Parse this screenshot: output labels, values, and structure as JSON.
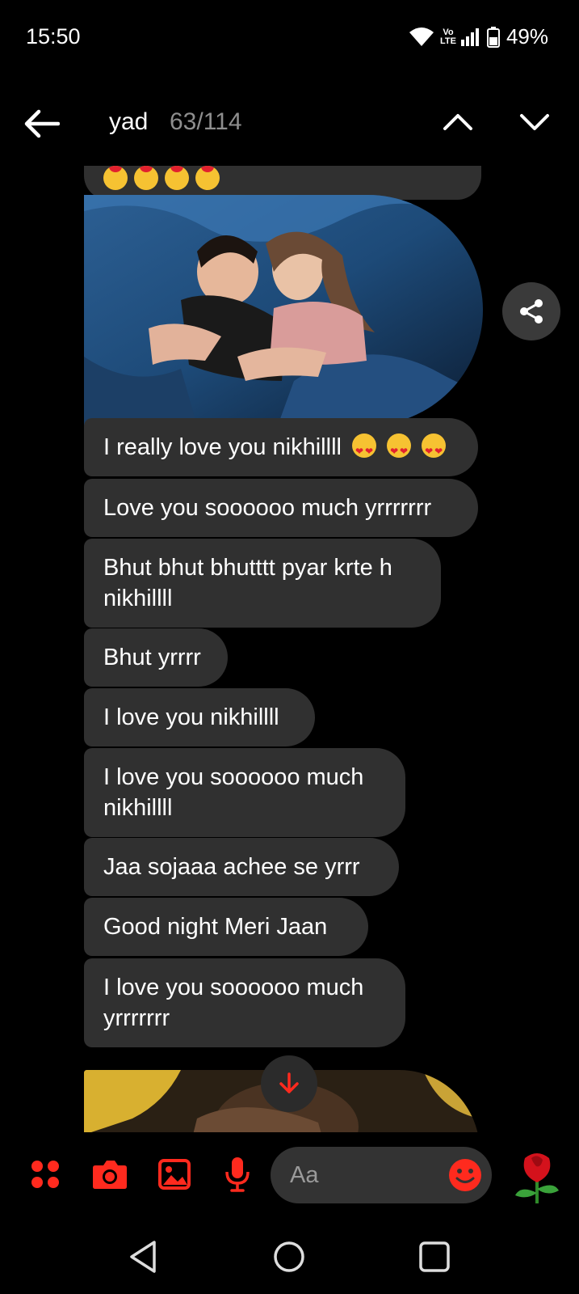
{
  "status_bar": {
    "time": "15:50",
    "volte_top": "Vo",
    "volte_bottom": "LTE",
    "battery": "49%"
  },
  "search": {
    "term": "yad",
    "match_count": "63/114",
    "back_icon": "arrow-left-icon",
    "prev_icon": "chevron-up-icon",
    "next_icon": "chevron-down-icon"
  },
  "messages": [
    "I really love you nikhillll",
    "Love you soooooo much yrrrrrrr",
    "Bhut bhut bhutttt pyar krte h\nnikhillll",
    "Bhut yrrrr",
    "I love you nikhillll",
    "I love you soooooo much\nnikhillll",
    "Jaa sojaaa achee se yrrr",
    "Good night Meri Jaan",
    "I love you soooooo much\nyrrrrrrr"
  ],
  "composer": {
    "placeholder": "Aa",
    "icons": [
      "grid-menu-icon",
      "camera-icon",
      "gallery-icon",
      "microphone-icon",
      "smiley-icon",
      "rose-icon"
    ]
  },
  "colors": {
    "accent": "#ff2a1e",
    "bubble": "#303030",
    "background": "#000000"
  },
  "nav": {
    "icons": [
      "back-triangle-icon",
      "home-circle-icon",
      "recents-square-icon"
    ]
  }
}
